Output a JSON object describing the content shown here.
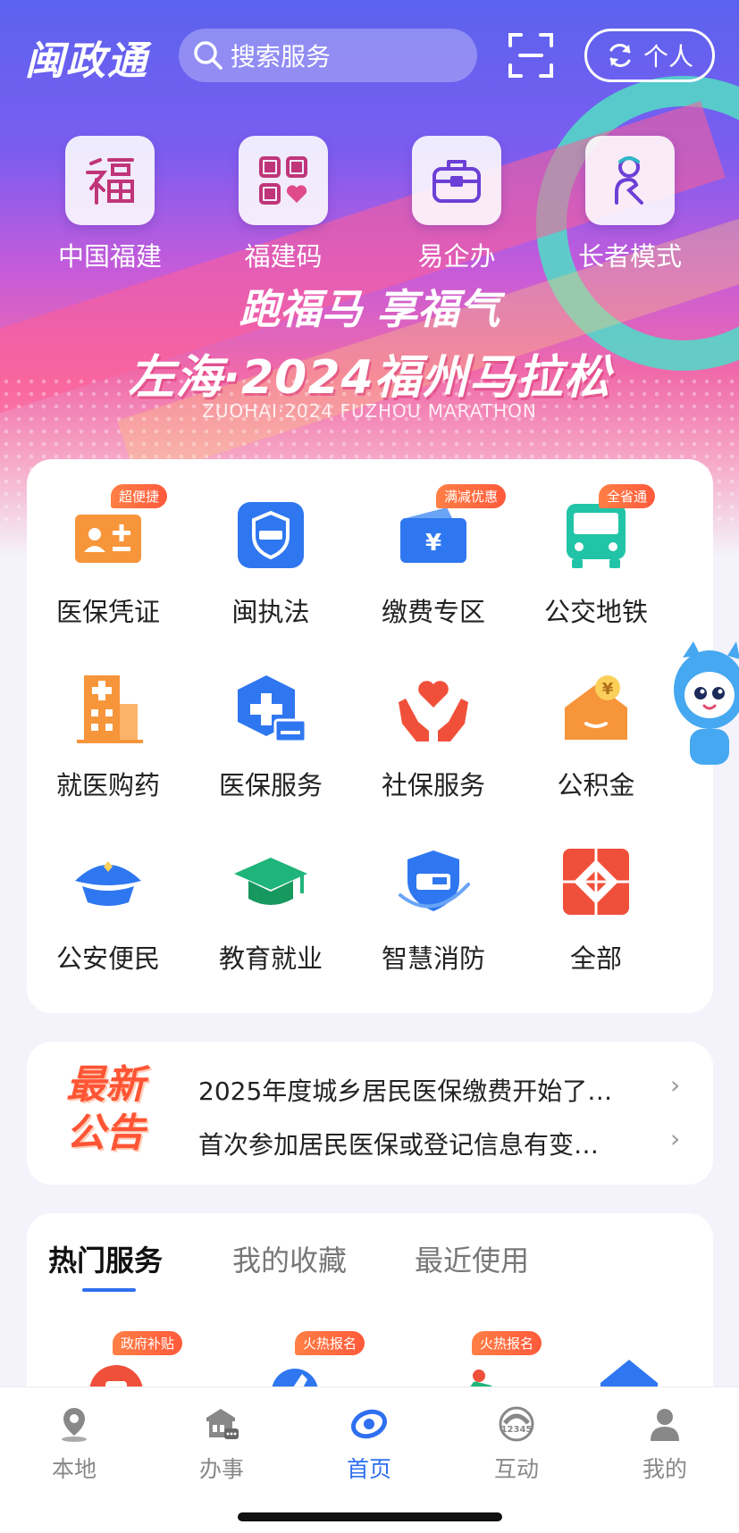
{
  "header": {
    "logo": "闽政通",
    "search_placeholder": "搜索服务",
    "personal_label": "个人"
  },
  "quick_tiles": [
    {
      "label": "中国福建",
      "icon": "fu-character-icon"
    },
    {
      "label": "福建码",
      "icon": "qr-code-heart-icon"
    },
    {
      "label": "易企办",
      "icon": "briefcase-icon"
    },
    {
      "label": "长者模式",
      "icon": "elder-person-icon"
    }
  ],
  "banner": {
    "slogan_line1": "跑福马 享福气",
    "slogan_line2": "左海·2024福州马拉松",
    "slogan_line3": "ZUOHAI·2024 FUZHOU MARATHON"
  },
  "services": [
    {
      "label": "医保凭证",
      "badge": "超便捷",
      "icon": "insurance-card-icon"
    },
    {
      "label": "闽执法",
      "badge": "",
      "icon": "law-enforcement-shield-icon"
    },
    {
      "label": "缴费专区",
      "badge": "满减优惠",
      "icon": "wallet-yen-icon"
    },
    {
      "label": "公交地铁",
      "badge": "全省通",
      "icon": "bus-icon"
    },
    {
      "label": "就医购药",
      "badge": "",
      "icon": "hospital-icon"
    },
    {
      "label": "医保服务",
      "badge": "",
      "icon": "medical-plus-icon"
    },
    {
      "label": "社保服务",
      "badge": "",
      "icon": "hands-heart-icon"
    },
    {
      "label": "公积金",
      "badge": "",
      "icon": "yen-envelope-icon"
    },
    {
      "label": "公安便民",
      "badge": "",
      "icon": "police-cap-icon"
    },
    {
      "label": "教育就业",
      "badge": "",
      "icon": "graduation-cap-icon"
    },
    {
      "label": "智慧消防",
      "badge": "",
      "icon": "fire-shield-icon"
    },
    {
      "label": "全部",
      "badge": "",
      "icon": "all-grid-icon"
    }
  ],
  "notice": {
    "title_line1": "最新",
    "title_line2": "公告",
    "items": [
      "2025年度城乡居民医保缴费开始了…",
      "首次参加居民医保或登记信息有变…"
    ],
    "chevron": "›"
  },
  "hot_section": {
    "tabs": [
      "热门服务",
      "我的收藏",
      "最近使用"
    ],
    "active_tab": 0,
    "item_badges": [
      "政府补贴",
      "火热报名",
      "火热报名",
      ""
    ]
  },
  "bottom_nav": [
    {
      "label": "本地",
      "icon": "location-pin-icon"
    },
    {
      "label": "办事",
      "icon": "building-chat-icon"
    },
    {
      "label": "首页",
      "icon": "home-logo-icon"
    },
    {
      "label": "互动",
      "icon": "hotline-12345-icon"
    },
    {
      "label": "我的",
      "icon": "user-icon"
    }
  ],
  "colors": {
    "accent": "#2f6ff0",
    "badge": "#ff5a3c",
    "notice_red": "#ff5534",
    "icon_orange": "#f7953a",
    "icon_blue": "#2f77f0",
    "icon_red": "#f0503a",
    "icon_green": "#1fb57a",
    "icon_teal": "#22c4a8"
  }
}
